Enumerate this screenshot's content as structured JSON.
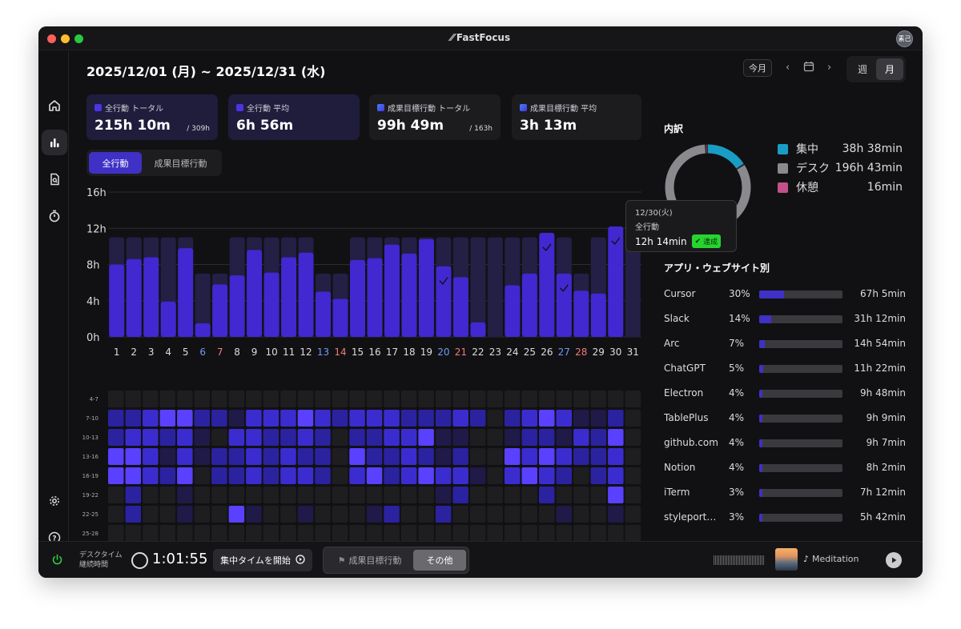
{
  "window": {
    "title": "FastFocus",
    "logo_glyph": "⁄⁄",
    "avatar": "素己"
  },
  "header": {
    "date_range": "2025/12/01 (月) ~ 2025/12/31 (水)",
    "today_label": "今月",
    "period_tabs": [
      "週",
      "月"
    ],
    "active_period": "月"
  },
  "stats": [
    {
      "label": "全行動 トータル",
      "value": "215h 10m",
      "sub": "/ 309h",
      "color": "#4b35e0"
    },
    {
      "label": "全行動 平均",
      "value": "6h 56m",
      "sub": "",
      "color": "#4b35e0"
    },
    {
      "label": "成果目標行動 トータル",
      "value": "99h 49m",
      "sub": "/ 163h",
      "color": "#3b5fe6"
    },
    {
      "label": "成果目標行動 平均",
      "value": "3h 13m",
      "sub": "",
      "color": "#3b5fe6"
    }
  ],
  "toggle": {
    "all": "全行動",
    "goal": "成果目標行動"
  },
  "chart_data": {
    "type": "bar",
    "categories": [
      "1",
      "2",
      "3",
      "4",
      "5",
      "6",
      "7",
      "8",
      "9",
      "10",
      "11",
      "12",
      "13",
      "14",
      "15",
      "16",
      "17",
      "18",
      "19",
      "20",
      "21",
      "22",
      "23",
      "24",
      "25",
      "26",
      "27",
      "28",
      "29",
      "30",
      "31"
    ],
    "series": [
      {
        "values": [
          8.0,
          8.6,
          8.8,
          3.9,
          9.8,
          1.5,
          5.8,
          6.8,
          9.6,
          7.1,
          8.8,
          9.3,
          5.0,
          4.2,
          8.5,
          8.7,
          10.2,
          9.2,
          10.8,
          7.8,
          6.6,
          1.6,
          0,
          5.7,
          7.0,
          11.5,
          7.0,
          5.1,
          4.8,
          12.2,
          0
        ]
      },
      {
        "values": [
          11,
          11,
          11,
          11,
          11,
          7,
          7,
          11,
          11,
          11,
          11,
          11,
          7,
          7,
          11,
          11,
          11,
          11,
          11,
          11,
          11,
          11,
          11,
          11,
          11,
          11,
          11,
          7,
          11,
          11,
          11
        ]
      }
    ],
    "achieved_days": [
      20,
      26,
      27,
      30
    ],
    "blue_days": [
      "6",
      "13",
      "20",
      "27"
    ],
    "red_days": [
      "7",
      "14",
      "21",
      "28"
    ],
    "y_ticks": [
      "0h",
      "4h",
      "8h",
      "12h",
      "16h"
    ],
    "ylim": [
      0,
      16
    ]
  },
  "heatmap": {
    "rows": [
      "4-7",
      "7-10",
      "10-13",
      "13-16",
      "16-19",
      "19-22",
      "22-25",
      "25-28"
    ],
    "levels": [
      [
        0,
        0,
        0,
        0,
        0,
        0,
        0,
        0,
        0,
        0,
        0,
        0,
        0,
        0,
        0,
        0,
        0,
        0,
        0,
        0,
        0,
        0,
        0,
        0,
        0,
        0,
        0,
        0,
        0,
        0,
        0
      ],
      [
        2,
        2,
        3,
        4,
        4,
        2,
        2,
        1,
        3,
        3,
        3,
        4,
        3,
        2,
        3,
        3,
        3,
        2,
        2,
        2,
        3,
        2,
        0,
        2,
        3,
        4,
        3,
        1,
        1,
        2,
        0
      ],
      [
        2,
        3,
        3,
        2,
        3,
        1,
        0,
        3,
        3,
        2,
        2,
        3,
        2,
        0,
        2,
        2,
        3,
        3,
        4,
        1,
        1,
        0,
        0,
        1,
        2,
        2,
        1,
        3,
        2,
        4,
        0
      ],
      [
        4,
        4,
        3,
        1,
        3,
        1,
        2,
        2,
        3,
        2,
        3,
        2,
        2,
        0,
        4,
        2,
        2,
        3,
        2,
        1,
        2,
        0,
        0,
        4,
        3,
        4,
        3,
        2,
        2,
        3,
        0
      ],
      [
        4,
        4,
        3,
        2,
        4,
        0,
        2,
        2,
        3,
        2,
        3,
        3,
        2,
        0,
        3,
        4,
        2,
        3,
        4,
        3,
        3,
        1,
        0,
        3,
        4,
        3,
        2,
        0,
        2,
        3,
        0
      ],
      [
        0,
        2,
        0,
        0,
        1,
        0,
        0,
        0,
        0,
        0,
        0,
        0,
        0,
        0,
        0,
        0,
        0,
        0,
        0,
        1,
        2,
        0,
        0,
        0,
        0,
        2,
        0,
        0,
        0,
        4,
        0
      ],
      [
        0,
        2,
        0,
        0,
        1,
        0,
        0,
        4,
        1,
        0,
        0,
        1,
        0,
        0,
        0,
        1,
        2,
        0,
        0,
        2,
        0,
        0,
        0,
        0,
        0,
        0,
        1,
        0,
        0,
        1,
        0
      ],
      [
        0,
        0,
        0,
        0,
        0,
        0,
        0,
        0,
        0,
        0,
        0,
        0,
        0,
        0,
        0,
        0,
        0,
        0,
        0,
        0,
        0,
        0,
        0,
        0,
        0,
        0,
        0,
        0,
        0,
        0,
        0
      ]
    ]
  },
  "breakdown": {
    "title": "内訳",
    "items": [
      {
        "name": "集中",
        "value": "38h 38min",
        "color": "#1a9dc4",
        "fraction": 0.163
      },
      {
        "name": "デスク",
        "value": "196h 43min",
        "color": "#8a8a8e",
        "fraction": 0.83
      },
      {
        "name": "休憩",
        "value": "16min",
        "color": "#c4508a",
        "fraction": 0.007
      }
    ]
  },
  "tooltip": {
    "date": "12/30(火)",
    "label": "全行動",
    "value": "12h 14min",
    "badge": "達成"
  },
  "apps": {
    "title": "アプリ・ウェブサイト別",
    "items": [
      {
        "name": "Cursor",
        "pct": "30%",
        "time": "67h 5min",
        "fraction": 0.3
      },
      {
        "name": "Slack",
        "pct": "14%",
        "time": "31h 12min",
        "fraction": 0.14
      },
      {
        "name": "Arc",
        "pct": "7%",
        "time": "14h 54min",
        "fraction": 0.07
      },
      {
        "name": "ChatGPT",
        "pct": "5%",
        "time": "11h 22min",
        "fraction": 0.05
      },
      {
        "name": "Electron",
        "pct": "4%",
        "time": "9h 48min",
        "fraction": 0.04
      },
      {
        "name": "TablePlus",
        "pct": "4%",
        "time": "9h 9min",
        "fraction": 0.04
      },
      {
        "name": "github.com",
        "pct": "4%",
        "time": "9h 7min",
        "fraction": 0.04
      },
      {
        "name": "Notion",
        "pct": "4%",
        "time": "8h 2min",
        "fraction": 0.04
      },
      {
        "name": "iTerm",
        "pct": "3%",
        "time": "7h 12min",
        "fraction": 0.03
      },
      {
        "name": "styleport…",
        "pct": "3%",
        "time": "5h 42min",
        "fraction": 0.03
      }
    ]
  },
  "bottom": {
    "desk_label_1": "デスクタイム",
    "desk_label_2": "継続時間",
    "timer": "1:01:55",
    "start_button": "集中タイムを開始",
    "mode_goal": "成果目標行動",
    "mode_other": "その他",
    "track": "Meditation"
  },
  "colors": {
    "accent": "#3f30c6",
    "bar": "#4128d0",
    "bar_bg": "#231f45"
  }
}
